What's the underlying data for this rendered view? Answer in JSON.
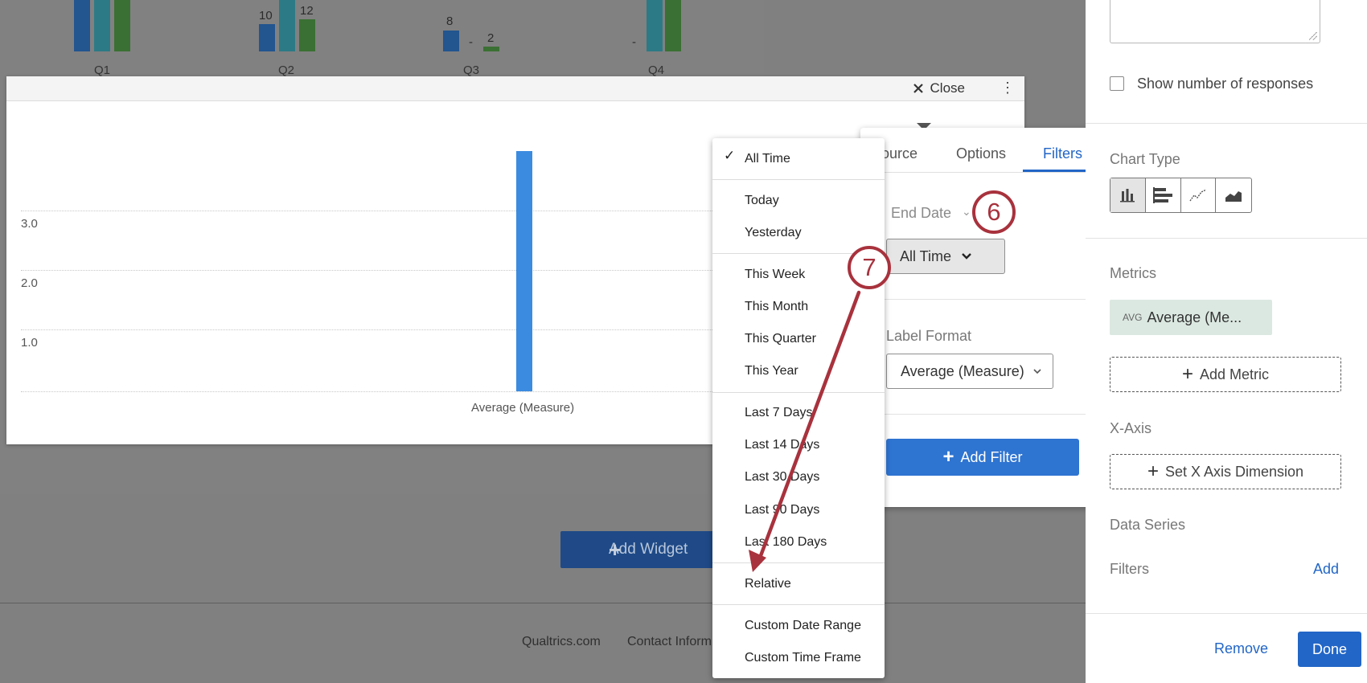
{
  "background": {
    "quarters": [
      "Q1",
      "Q2",
      "Q3",
      "Q4"
    ],
    "q2_values": [
      "10",
      "12"
    ],
    "q3_values": [
      "8",
      "-",
      "2"
    ],
    "q4_values": [
      "-"
    ],
    "add_widget_label": "Add Widget",
    "footer_links": [
      "Qualtrics.com",
      "Contact Inform"
    ]
  },
  "modal": {
    "close_label": "Close",
    "y_ticks": [
      "3.0",
      "2.0",
      "1.0"
    ],
    "x_label": "Average (Measure)"
  },
  "chart_data": {
    "type": "bar",
    "categories": [
      "Average (Measure)"
    ],
    "series": [
      {
        "values": [
          4.0
        ]
      }
    ],
    "yticks": [
      "1.0",
      "2.0",
      "3.0"
    ],
    "ylim": [
      0,
      4.0
    ],
    "grid": true
  },
  "popover": {
    "tabs": [
      "ource",
      "Options",
      "Filters"
    ],
    "end_date_label": "End Date",
    "end_date_value": "All Time",
    "label_format_label": "Label Format",
    "label_format_value": "Average (Measure)",
    "add_filter_label": "Add Filter"
  },
  "date_menu": {
    "selected": "All Time",
    "groups": [
      [
        "All Time"
      ],
      [
        "Today",
        "Yesterday"
      ],
      [
        "This Week",
        "This Month",
        "This Quarter",
        "This Year"
      ],
      [
        "Last 7 Days",
        "Last 14 Days",
        "Last 30 Days",
        "Last 90 Days",
        "Last 180 Days"
      ],
      [
        "Relative"
      ],
      [
        "Custom Date Range",
        "Custom Time Frame"
      ]
    ]
  },
  "sidebar": {
    "show_responses_label": "Show number of responses",
    "chart_type_label": "Chart Type",
    "chart_types": [
      "bar-chart-icon",
      "horizontal-bar-icon",
      "line-chart-icon",
      "area-chart-icon"
    ],
    "metrics_label": "Metrics",
    "metric_prefix": "AVG",
    "metric_name": "Average (Me...",
    "add_metric_label": "Add Metric",
    "x_axis_label": "X-Axis",
    "set_x_axis_label": "Set X Axis Dimension",
    "data_series_label": "Data Series",
    "filters_label": "Filters",
    "filters_add_label": "Add",
    "remove_label": "Remove",
    "done_label": "Done"
  },
  "annotations": {
    "step_6": "6",
    "step_7": "7",
    "color": "#a8323d"
  }
}
